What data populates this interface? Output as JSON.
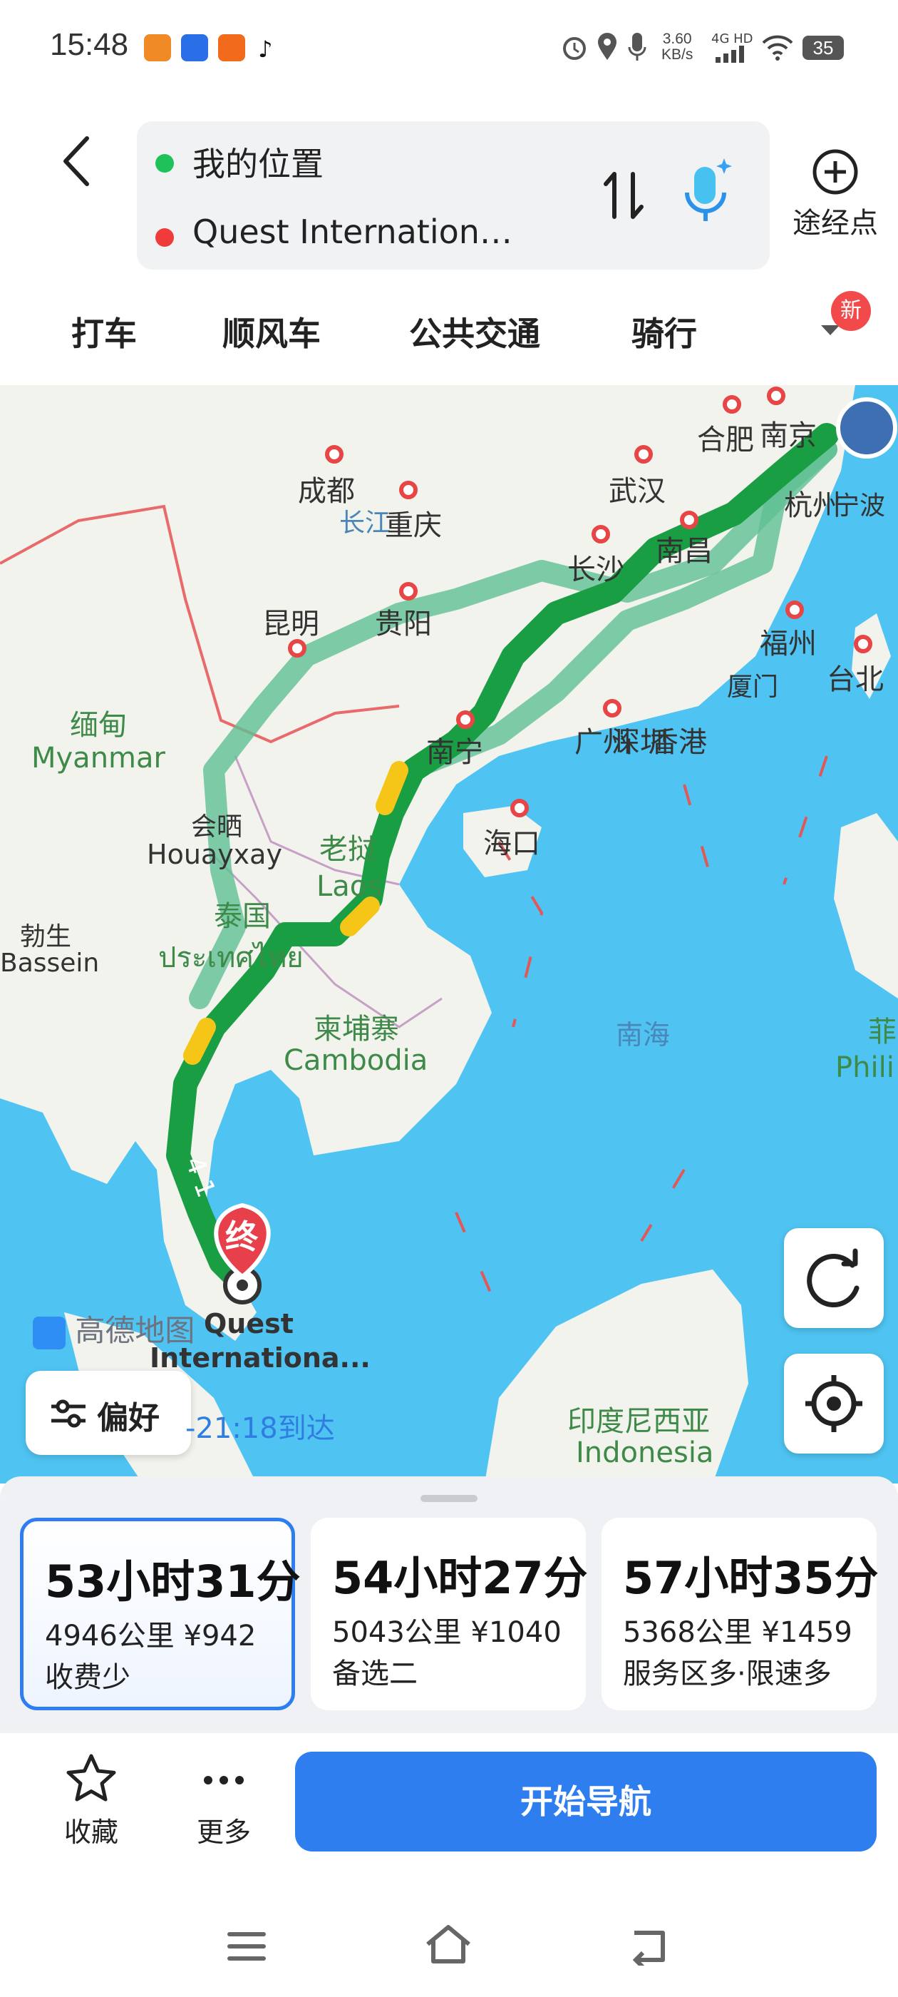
{
  "status_bar": {
    "time": "15:48",
    "net_speed_value": "3.60",
    "net_speed_unit": "KB/s",
    "network": "4G HD",
    "battery": "35",
    "icons": [
      "alarm-icon",
      "location-icon",
      "mic-icon",
      "signal-icon",
      "wifi-icon"
    ]
  },
  "route": {
    "origin": "我的位置",
    "destination": "Quest Internation…",
    "waypoint_label": "途经点"
  },
  "tabs": [
    {
      "label": "打车"
    },
    {
      "label": "顺风车"
    },
    {
      "label": "公共交通"
    },
    {
      "label": "骑行"
    }
  ],
  "new_badge": "新",
  "map": {
    "labels": {
      "chengdu": "成都",
      "chongqing": "重庆",
      "changjiang": "长江",
      "wuhan": "武汉",
      "hefei": "合肥",
      "nanjing": "南京",
      "hangzhou": "杭州",
      "ningbo": "宁波",
      "changsha": "长沙",
      "nanchang": "南昌",
      "kunming": "昆明",
      "guiyang": "贵阳",
      "fuzhou": "福州",
      "taibei": "台北",
      "xiamen": "厦门",
      "nanning": "南宁",
      "guangzhou": "广州",
      "shenzhen": "深圳",
      "xianggang": "香港",
      "haikou": "海口",
      "miandian": "缅甸",
      "myanmar": "Myanmar",
      "huixi": "会晒",
      "houayxay": "Houayxay",
      "laowo": "老挝",
      "laos": "Laos",
      "taiguo": "泰国",
      "thai": "ประเทศไทย",
      "bosheng": "勃生",
      "bassein": "Bassein",
      "jianpuzhai": "柬埔寨",
      "cambodia": "Cambodia",
      "nanhai": "南海",
      "fei": "菲",
      "phili": "Phili",
      "yinni": "印度尼西亚",
      "indonesia": "Indonesia",
      "route_number": "4 1",
      "end_marker": "终",
      "dest_label_1": "Quest",
      "dest_label_2": "Internationa..."
    },
    "logo": "高德地图",
    "preference_label": "偏好",
    "arrival_text": "-21:18到达"
  },
  "route_options": [
    {
      "duration": "53小时31分",
      "distance": "4946公里",
      "cost": "¥942",
      "tag": "收费少",
      "selected": true
    },
    {
      "duration": "54小时27分",
      "distance": "5043公里",
      "cost": "¥1040",
      "tag": "备选二",
      "selected": false
    },
    {
      "duration": "57小时35分",
      "distance": "5368公里",
      "cost": "¥1459",
      "tag": "服务区多·限速多",
      "selected": false
    }
  ],
  "actions": {
    "favorite": "收藏",
    "more": "更多",
    "start_navigation": "开始导航"
  },
  "colors": {
    "accent_blue": "#2e7ef0",
    "route_green": "#1fa84a",
    "alt_route": "#5fbf93",
    "sea": "#4fc4f2",
    "land": "#f3f3ee",
    "pin_red": "#e74646"
  }
}
